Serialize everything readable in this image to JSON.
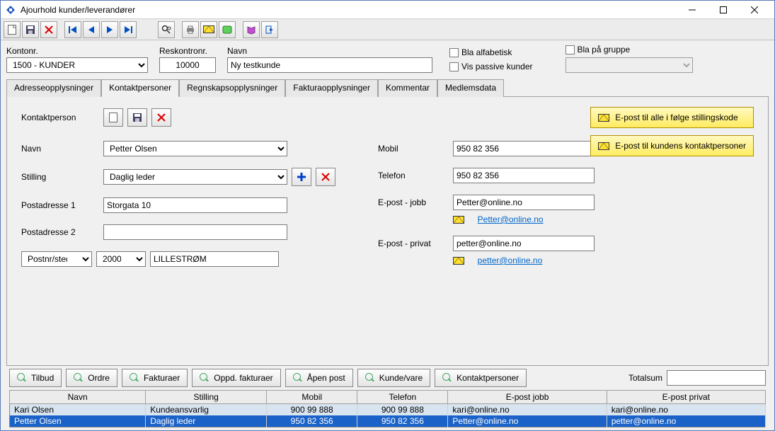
{
  "window": {
    "title": "Ajourhold kunder/leverandører"
  },
  "top": {
    "kontonr_label": "Kontonr.",
    "kontonr_value": "1500 - KUNDER",
    "reskontronr_label": "Reskontronr.",
    "reskontronr_value": "10000",
    "navn_label": "Navn",
    "navn_value": "Ny testkunde",
    "bla_alfabetisk": "Bla alfabetisk",
    "vis_passive": "Vis passive kunder",
    "bla_gruppe": "Bla på gruppe"
  },
  "tabs": {
    "adresse": "Adresseopplysninger",
    "kontakt": "Kontaktpersoner",
    "regnskap": "Regnskapsopplysninger",
    "faktura": "Fakturaopplysninger",
    "kommentar": "Kommentar",
    "medlem": "Medlemsdata"
  },
  "form": {
    "kontaktperson": "Kontaktperson",
    "navn_label": "Navn",
    "navn_value": "Petter Olsen",
    "stilling_label": "Stilling",
    "stilling_value": "Daglig leder",
    "postadr1_label": "Postadresse 1",
    "postadr1_value": "Storgata 10",
    "postadr2_label": "Postadresse 2",
    "postadr2_value": "",
    "postnr_label": "Postnr/sted",
    "postnr_value": "2000",
    "poststed_value": "LILLESTRØM",
    "mobil_label": "Mobil",
    "mobil_value": "950 82 356",
    "telefon_label": "Telefon",
    "telefon_value": "950 82 356",
    "epost_jobb_label": "E-post  -  jobb",
    "epost_jobb_value": "Petter@online.no",
    "epost_jobb_link": "Petter@online.no",
    "epost_priv_label": "E-post -  privat",
    "epost_priv_value": "petter@online.no",
    "epost_priv_link": "petter@online.no",
    "btn_stillingskode": "E-post til alle i følge stillingskode",
    "btn_kontaktpersoner": "E-post til kundens kontaktpersoner"
  },
  "bottom": {
    "tilbud": "Tilbud",
    "ordre": "Ordre",
    "fakturaer": "Fakturaer",
    "oppd": "Oppd. fakturaer",
    "apenpost": "Åpen post",
    "kundevare": "Kunde/vare",
    "kontaktpersoner": "Kontaktpersoner",
    "totalsum": "Totalsum",
    "totalsum_value": ""
  },
  "grid": {
    "headers": {
      "navn": "Navn",
      "stilling": "Stilling",
      "mobil": "Mobil",
      "telefon": "Telefon",
      "epost_jobb": "E-post jobb",
      "epost_privat": "E-post privat"
    },
    "rows": [
      {
        "navn": "Kari Olsen",
        "stilling": "Kundeansvarlig",
        "mobil": "900 99 888",
        "telefon": "900 99 888",
        "epost_jobb": "kari@online.no",
        "epost_privat": "kari@online.no"
      },
      {
        "navn": "Petter Olsen",
        "stilling": "Daglig leder",
        "mobil": "950 82 356",
        "telefon": "950 82 356",
        "epost_jobb": "Petter@online.no",
        "epost_privat": "petter@online.no"
      }
    ]
  }
}
